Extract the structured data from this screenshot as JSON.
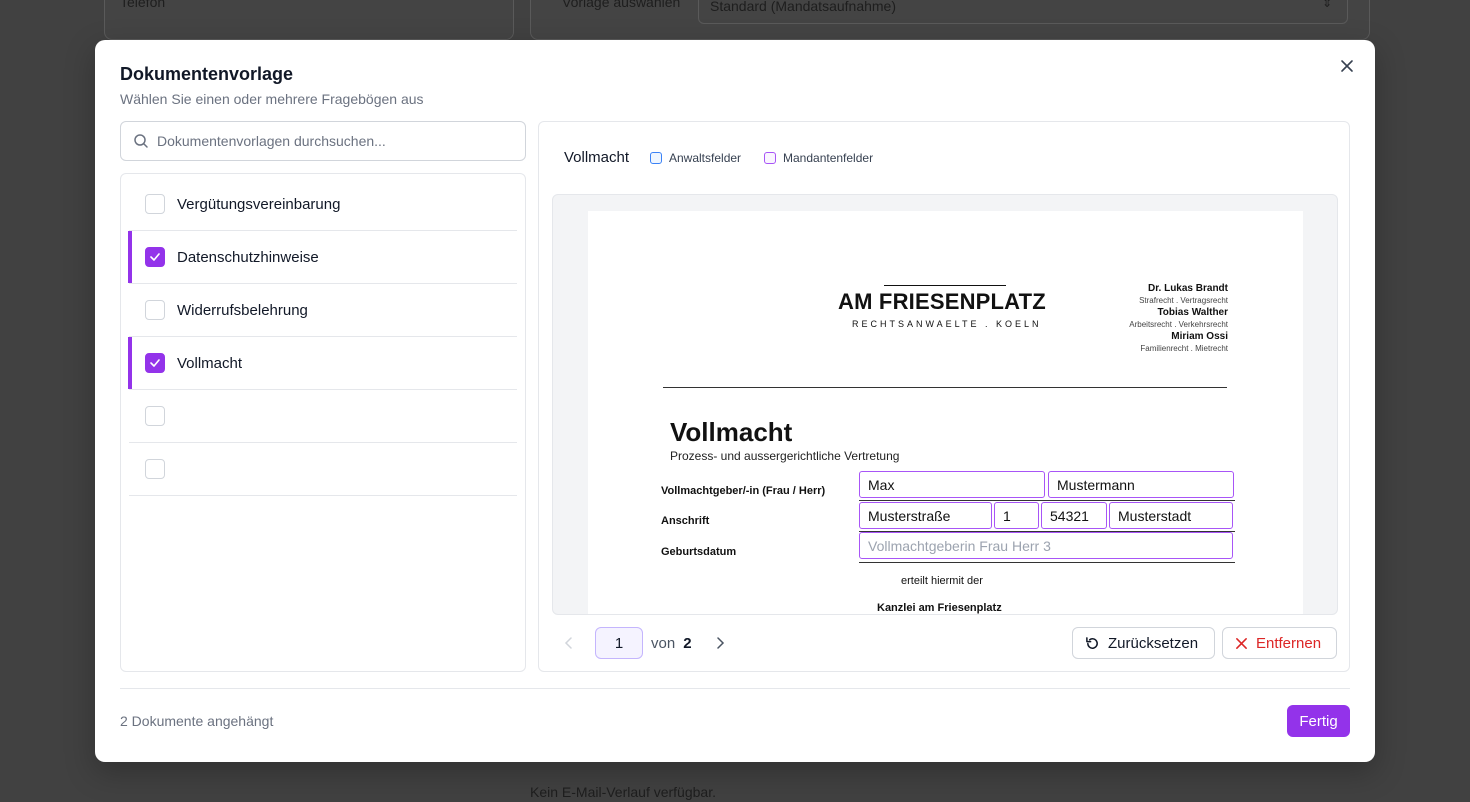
{
  "background": {
    "left_label": "Telefon",
    "right_label": "Vorlage auswählen",
    "select_value": "Standard (Mandatsaufnahme)",
    "bottom_text": "Kein E-Mail-Verlauf verfügbar."
  },
  "modal": {
    "title": "Dokumentenvorlage",
    "subtitle": "Wählen Sie einen oder mehrere Fragebögen aus",
    "search_placeholder": "Dokumentenvorlagen durchsuchen...",
    "templates": [
      {
        "label": "Vergütungsvereinbarung",
        "checked": false
      },
      {
        "label": "Datenschutzhinweise",
        "checked": true
      },
      {
        "label": "Widerrufsbelehrung",
        "checked": false
      },
      {
        "label": "Vollmacht",
        "checked": true
      },
      {
        "label": "",
        "checked": false
      },
      {
        "label": "",
        "checked": false
      }
    ],
    "footer_status": "2 Dokumente angehängt",
    "done_label": "Fertig"
  },
  "preview": {
    "title": "Vollmacht",
    "legend": {
      "lawyer_fields": "Anwaltsfelder",
      "client_fields": "Mandantenfelder",
      "lawyer_color": "#3b82f6",
      "client_color": "#a855f7"
    },
    "document": {
      "firm_name": "AM FRIESENPLATZ",
      "firm_sub": "RECHTSANWAELTE . KOELN",
      "lawyers": [
        {
          "name": "Dr. Lukas Brandt",
          "spec": "Strafrecht . Vertragsrecht"
        },
        {
          "name": "Tobias Walther",
          "spec": "Arbeitsrecht . Verkehrsrecht"
        },
        {
          "name": "Miriam Ossi",
          "spec": "Familienrecht . Mietrecht"
        }
      ],
      "heading": "Vollmacht",
      "subheading": "Prozess- und aussergerichtliche Vertretung",
      "label_principal": "Vollmachtgeber/-in (Frau / Herr)",
      "label_address": "Anschrift",
      "label_birthdate": "Geburtsdatum",
      "first_name": "Max",
      "last_name": "Mustermann",
      "street": "Musterstraße",
      "house_no": "1",
      "zip": "54321",
      "city": "Musterstadt",
      "birthdate_placeholder": "Vollmachtgeberin Frau Herr 3",
      "grants_text": "erteilt hiermit der",
      "firm_full": "Kanzlei am Friesenplatz"
    },
    "pagination": {
      "current": "1",
      "of_label": "von",
      "total": "2"
    },
    "reset_label": "Zurücksetzen",
    "remove_label": "Entfernen"
  }
}
